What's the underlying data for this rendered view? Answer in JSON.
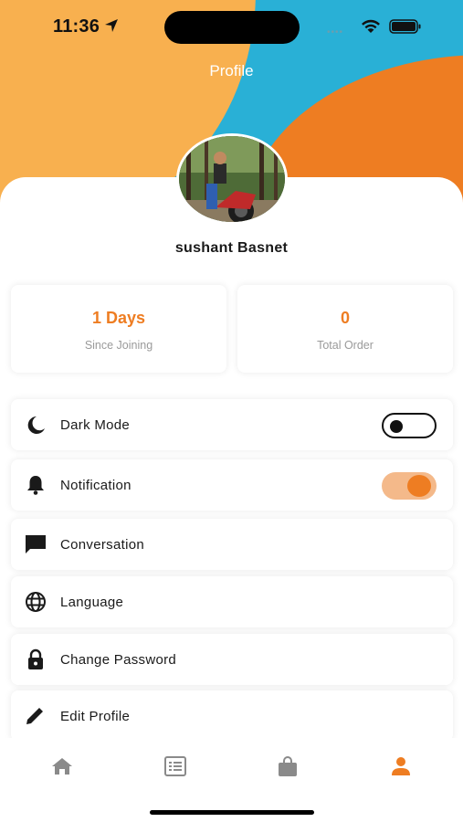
{
  "status_bar": {
    "time": "11:36",
    "signal_icon": "signal-dots-icon",
    "wifi_icon": "wifi-icon",
    "battery_icon": "battery-icon"
  },
  "header": {
    "title": "Profile",
    "colors": {
      "yellow": "#f8b04f",
      "blue": "#29b0d6",
      "orange": "#ee7d22"
    }
  },
  "profile": {
    "name": "sushant Basnet"
  },
  "stats": [
    {
      "value": "1 Days",
      "label": "Since Joining"
    },
    {
      "value": "0",
      "label": "Total Order"
    }
  ],
  "menu": [
    {
      "label": "Dark Mode",
      "icon": "moon-icon",
      "toggle": false
    },
    {
      "label": "Notification",
      "icon": "bell-icon",
      "toggle": true
    },
    {
      "label": "Conversation",
      "icon": "chat-icon"
    },
    {
      "label": "Language",
      "icon": "globe-icon"
    },
    {
      "label": "Change Password",
      "icon": "lock-icon"
    },
    {
      "label": "Edit Profile",
      "icon": "pencil-icon"
    }
  ],
  "tab_bar": {
    "tabs": [
      {
        "icon": "home-icon",
        "active": false
      },
      {
        "icon": "list-icon",
        "active": false
      },
      {
        "icon": "shopping-bag-icon",
        "active": false
      },
      {
        "icon": "person-icon",
        "active": true
      }
    ],
    "active_color": "#ee7d22",
    "inactive_color": "#8a8a8a"
  }
}
